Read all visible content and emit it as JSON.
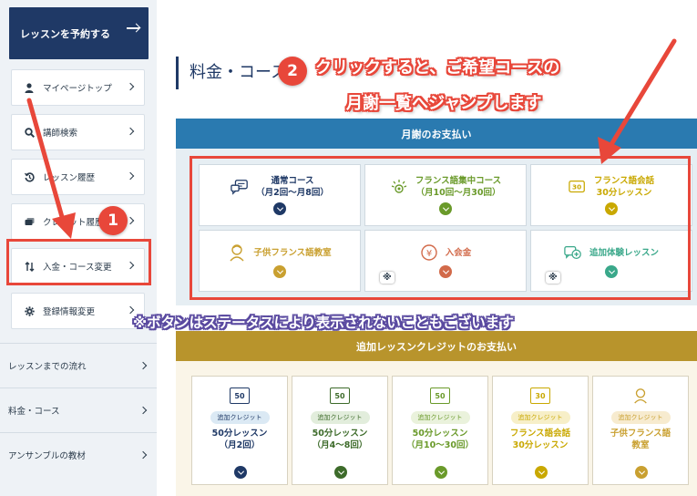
{
  "sidebar": {
    "reserve_button": "レッスンを予約する",
    "menu": [
      {
        "label": "マイページトップ",
        "icon": "person-icon"
      },
      {
        "label": "講師検索",
        "icon": "search-icon"
      },
      {
        "label": "レッスン履歴",
        "icon": "history-icon"
      },
      {
        "label": "クレジット履歴",
        "icon": "credit-icon"
      },
      {
        "label": "入金・コース変更",
        "icon": "sort-icon"
      },
      {
        "label": "登録情報変更",
        "icon": "gear-icon"
      }
    ],
    "lower_nav": [
      "レッスンまでの流れ",
      "料金・コース",
      "アンサンブルの教材"
    ]
  },
  "main": {
    "page_title": "料金・コース",
    "monthly_header": "月謝のお支払い",
    "monthly_cards": [
      {
        "label": "通常コース\n（月2回〜月8回）",
        "color": "#1f3966",
        "icon": "chat-icon",
        "asterisk": ""
      },
      {
        "label": "フランス語集中コース\n（月10回〜月30回）",
        "color": "#6a9a2a",
        "icon": "focus-icon",
        "asterisk": ""
      },
      {
        "label": "フランス語会話\n30分レッスン",
        "color": "#c9a800",
        "icon": "number-30-icon",
        "asterisk": ""
      },
      {
        "label": "子供フランス語教室",
        "color": "#c9a030",
        "icon": "child-icon",
        "asterisk": ""
      },
      {
        "label": "入会金",
        "color": "#d26a4a",
        "icon": "yen-icon",
        "asterisk": "※"
      },
      {
        "label": "追加体験レッスン",
        "color": "#3aa88a",
        "icon": "chat-plus-icon",
        "asterisk": "※"
      }
    ],
    "credit_header": "追加レッスンクレジットのお支払い",
    "credit_cards": [
      {
        "icon_text": "50",
        "pill": "追加クレジット",
        "label": "50分レッスン\n（月2回）",
        "color": "#1f3966",
        "pill_bg": "#dbe9f4"
      },
      {
        "icon_text": "50",
        "pill": "追加クレジット",
        "label": "50分レッスン\n（月4〜8回）",
        "color": "#3d6b2a",
        "pill_bg": "#e2eddc"
      },
      {
        "icon_text": "50",
        "pill": "追加クレジット",
        "label": "50分レッスン\n（月10〜30回）",
        "color": "#6a9a2a",
        "pill_bg": "#eaf2dc"
      },
      {
        "icon_text": "30",
        "pill": "追加クレジット",
        "label": "フランス語会話\n30分レッスン",
        "color": "#c9a800",
        "pill_bg": "#f7efc8"
      },
      {
        "icon_text": "",
        "pill": "追加クレジット",
        "label": "子供フランス語\n教室",
        "color": "#c9a030",
        "pill_bg": "#f7ebcf"
      }
    ]
  },
  "annotations": {
    "badge1": "1",
    "badge2": "2",
    "callout_line1": "クリックすると、ご希望コースの",
    "callout_line2": "月謝一覧へジャンプします",
    "note": "※ボタンはステータスにより表示されないこともございます",
    "color": "#e8473a"
  }
}
